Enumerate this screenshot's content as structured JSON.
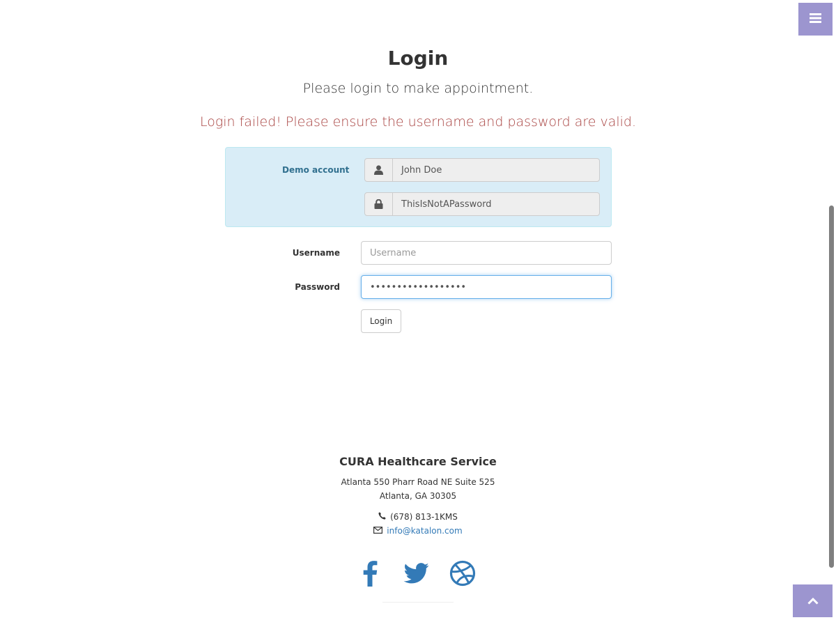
{
  "nav": {
    "menu_icon": "bars-icon",
    "scroll_top_icon": "chevron-up-icon"
  },
  "header": {
    "title": "Login",
    "subtitle": "Please login to make appointment.",
    "error": "Login failed! Please ensure the username and password are valid."
  },
  "demo": {
    "label": "Demo account",
    "username": "John Doe",
    "password": "ThisIsNotAPassword",
    "user_icon": "user-icon",
    "lock_icon": "lock-icon"
  },
  "form": {
    "username_label": "Username",
    "username_placeholder": "Username",
    "username_value": "",
    "password_label": "Password",
    "password_value": "••••••••••••••••••",
    "login_button": "Login"
  },
  "footer": {
    "company": "CURA Healthcare Service",
    "address_line1": "Atlanta 550 Pharr Road NE Suite 525",
    "address_line2": "Atlanta, GA 30305",
    "phone": "(678) 813-1KMS",
    "email": "info@katalon.com",
    "social_icons": [
      "facebook-icon",
      "twitter-icon",
      "dribbble-icon"
    ]
  },
  "colors": {
    "accent_purple": "#9c95cf",
    "error_red": "#a94442",
    "demo_bg": "#d9edf7",
    "demo_text": "#31708f",
    "link_blue": "#337ab7"
  }
}
